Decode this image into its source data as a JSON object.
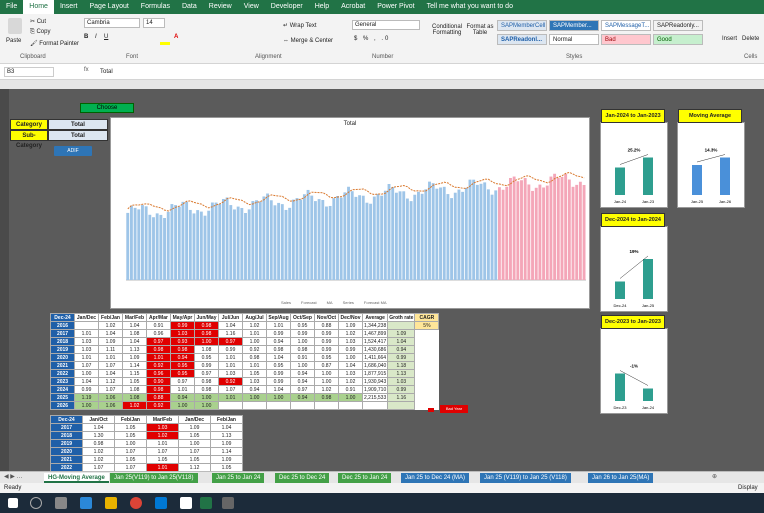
{
  "ribbon_tabs": [
    "File",
    "Home",
    "Insert",
    "Page Layout",
    "Formulas",
    "Data",
    "Review",
    "View",
    "Developer",
    "Help",
    "Acrobat",
    "Power Pivot",
    "Tell me what you want to do"
  ],
  "clipboard": {
    "paste": "Paste",
    "cut": "Cut",
    "copy": "Copy",
    "format_painter": "Format Painter",
    "label": "Clipboard"
  },
  "font": {
    "name": "Cambria",
    "size": "14",
    "label": "Font"
  },
  "alignment": {
    "wrap": "Wrap Text",
    "merge": "Merge & Center",
    "label": "Alignment"
  },
  "number": {
    "format": "General",
    "label": "Number"
  },
  "styles_group": {
    "cond": "Conditional Formatting",
    "table": "Format as Table",
    "label": "Styles",
    "boxes": [
      "SAPMemberCell",
      "SAPMember...",
      "SAPMessageT...",
      "SAPReadonly...",
      "SAPReadonl...",
      "Normal",
      "Bad",
      "Good"
    ]
  },
  "cells_group": {
    "insert": "Insert",
    "delete": "Delete",
    "label": "Cells"
  },
  "formula_bar": {
    "name_box": "B3",
    "formula": "Total"
  },
  "colors": {
    "excel_green": "#217346",
    "year_blue": "#1f5fa8",
    "bar_teal": "#2e9e8f",
    "bar_blue": "#4a90d9",
    "red": "#e00000",
    "yellow": "#ffff00"
  },
  "slicers": {
    "category_label": "Category",
    "category_value": "Total",
    "sub_label": "Sub-Category",
    "sub_value": "Total",
    "choose_btn": "Choose",
    "addin_btn": "ADIF"
  },
  "main_chart": {
    "title": "Total",
    "legend": [
      "Sales",
      "Forecast",
      "MA",
      "Series",
      "Forecast MA"
    ]
  },
  "mini_charts": [
    {
      "title": "Jan-2024 to Jan-2023",
      "pct": "25.2%",
      "labels": [
        "Jan-24",
        "Jan-23"
      ]
    },
    {
      "title": "Moving Average",
      "pct": "14.3%",
      "labels": [
        "Jan-25",
        "Jan-26"
      ]
    },
    {
      "title": "Dec-2024 to Jan-2024",
      "pct": "19%",
      "labels": [
        "Dec-24",
        "Jan-25"
      ]
    },
    {
      "title": "Dec-2023 to Jan-2023",
      "pct": "-1%",
      "labels": [
        "Dec-23",
        "Jan-24"
      ]
    }
  ],
  "ratio_table": {
    "corner": "Dec-24",
    "headers": [
      "Jan/Dec",
      "Feb/Jan",
      "Mar/Feb",
      "Apr/Mar",
      "May/Apr",
      "Jun/May",
      "Jul/Jun",
      "Aug/Jul",
      "Sep/Aug",
      "Oct/Sep",
      "Nov/Oct",
      "Dec/Nov",
      "Average",
      "Groth rate",
      "CAGR"
    ],
    "cagr": "5%",
    "rows": [
      {
        "year": "2016",
        "vals": [
          "",
          "1.02",
          "1.04",
          "0.91",
          "0.99",
          "0.98",
          "1.04",
          "1.02",
          "1.01",
          "0.95",
          "0.88",
          "1.09"
        ],
        "avg": "1,344,238",
        "gr": ""
      },
      {
        "year": "2017",
        "vals": [
          "1.01",
          "1.04",
          "1.08",
          "0.96",
          "1.03",
          "0.98",
          "1.16",
          "1.01",
          "0.99",
          "0.99",
          "0.99",
          "1.02"
        ],
        "avg": "1,467,899",
        "gr": "1.09"
      },
      {
        "year": "2018",
        "vals": [
          "1.03",
          "1.09",
          "1.04",
          "0.97",
          "0.93",
          "1.00",
          "0.97",
          "1.00",
          "0.94",
          "1.00",
          "0.99",
          "1.03"
        ],
        "avg": "1,524,417",
        "gr": "1.04"
      },
      {
        "year": "2019",
        "vals": [
          "1.03",
          "1.11",
          "1.13",
          "0.98",
          "0.98",
          "1.08",
          "0.99",
          "0.92",
          "0.98",
          "0.98",
          "0.99",
          "0.99"
        ],
        "avg": "1,430,686",
        "gr": "0.94"
      },
      {
        "year": "2020",
        "vals": [
          "1.01",
          "1.01",
          "1.09",
          "1.01",
          "0.94",
          "0.95",
          "1.01",
          "0.98",
          "1.04",
          "0.91",
          "0.95",
          "1.00"
        ],
        "avg": "1,411,664",
        "gr": "0.99"
      },
      {
        "year": "2021",
        "vals": [
          "1.07",
          "1.07",
          "1.14",
          "0.92",
          "0.95",
          "0.99",
          "1.01",
          "1.01",
          "0.95",
          "1.00",
          "0.87",
          "1.04"
        ],
        "avg": "1,686,040",
        "gr": "1.18"
      },
      {
        "year": "2022",
        "vals": [
          "1.00",
          "1.04",
          "1.15",
          "0.96",
          "0.95",
          "0.97",
          "1.03",
          "1.05",
          "0.99",
          "0.94",
          "1.00",
          "1.03"
        ],
        "avg": "1,877,915",
        "gr": "1.13"
      },
      {
        "year": "2023",
        "vals": [
          "1.04",
          "1.12",
          "1.05",
          "0.90",
          "0.97",
          "0.98",
          "0.92",
          "1.03",
          "0.99",
          "0.94",
          "1.00",
          "1.02"
        ],
        "avg": "1,930,943",
        "gr": "1.03"
      },
      {
        "year": "2024",
        "vals": [
          "0.99",
          "1.07",
          "1.08",
          "0.98",
          "1.01",
          "0.98",
          "1.07",
          "0.94",
          "1.04",
          "0.97",
          "1.02",
          "0.91"
        ],
        "avg": "1,909,710",
        "gr": "0.99"
      },
      {
        "year": "2025",
        "vals": [
          "1.19",
          "1.06",
          "1.08",
          "0.88",
          "0.94",
          "1.00",
          "1.01",
          "1.00",
          "1.00",
          "0.94",
          "0.98",
          "1.00"
        ],
        "avg": "2,215,533",
        "gr": "1.16"
      },
      {
        "year": "2026",
        "vals": [
          "1.00",
          "1.06",
          "1.02",
          "0.92",
          "1.00",
          "1.00",
          "",
          "",
          "",
          "",
          "",
          ""
        ],
        "avg": "",
        "gr": ""
      }
    ],
    "legend_red": "Bad Year"
  },
  "small_table": {
    "corner": "Dec-24",
    "headers": [
      "Jan/Oct",
      "Feb/Jan",
      "Mar/Feb",
      "Jan/Dec",
      "Feb/Jan"
    ],
    "rows": [
      {
        "year": "2017",
        "vals": [
          "1.04",
          "1.05",
          "1.03",
          "1.09",
          "1.04"
        ]
      },
      {
        "year": "2018",
        "vals": [
          "1.30",
          "1.05",
          "1.02",
          "1.05",
          "1.13"
        ]
      },
      {
        "year": "2019",
        "vals": [
          "0.98",
          "1.00",
          "1.01",
          "1.00",
          "1.09"
        ]
      },
      {
        "year": "2020",
        "vals": [
          "1.02",
          "1.07",
          "1.07",
          "1.07",
          "1.14"
        ]
      },
      {
        "year": "2021",
        "vals": [
          "1.02",
          "1.05",
          "1.05",
          "1.05",
          "1.09"
        ]
      },
      {
        "year": "2022",
        "vals": [
          "1.07",
          "1.07",
          "1.01",
          "1.12",
          "1.05"
        ]
      }
    ]
  },
  "sheet_tabs": [
    {
      "label": "HG-Moving Average",
      "color": "#ffffff",
      "text": "#217346"
    },
    {
      "label": "Jan 25(V119) to Jan 25(V118)",
      "color": "#43a047",
      "text": "#fff"
    },
    {
      "label": "Jan 25 to Jan 24",
      "color": "#43a047",
      "text": "#fff"
    },
    {
      "label": "Dec 25 to Dec 24",
      "color": "#43a047",
      "text": "#fff"
    },
    {
      "label": "Dec 25 to Jan 24",
      "color": "#43a047",
      "text": "#fff"
    },
    {
      "label": "Jan 25 to Dec 24 (MA)",
      "color": "#2e75b6",
      "text": "#fff"
    },
    {
      "label": "Jan 25 (V119) to Jan 25 (V118)",
      "color": "#2e75b6",
      "text": "#fff"
    },
    {
      "label": "Jan 26 to Jan 25(MA)",
      "color": "#2e75b6",
      "text": "#fff"
    }
  ],
  "status": {
    "ready": "Ready",
    "display": "Display"
  }
}
